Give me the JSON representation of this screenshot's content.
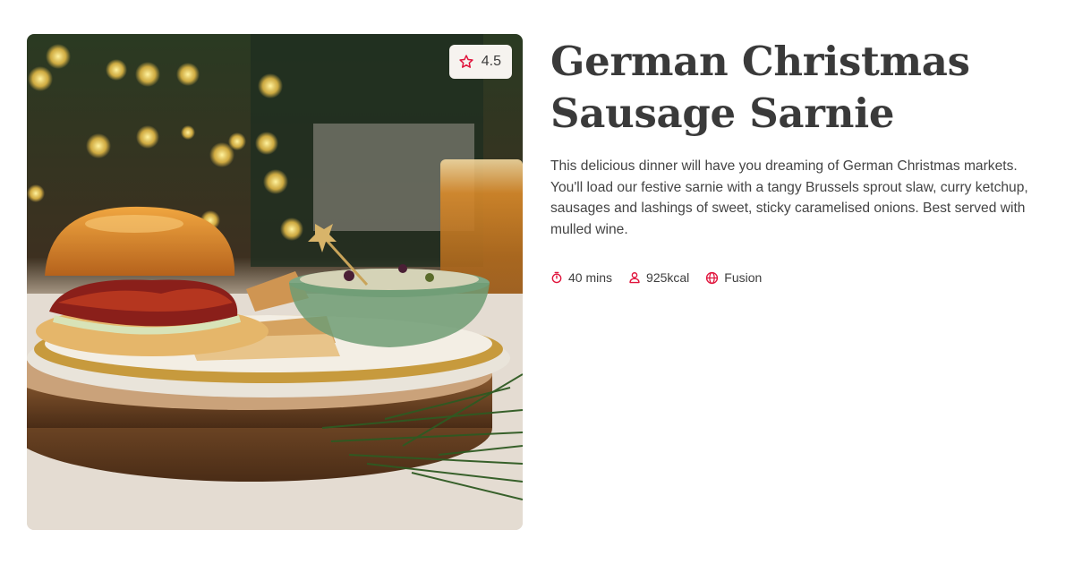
{
  "recipe": {
    "title": "German Christmas Sausage Sarnie",
    "description": "This delicious dinner will have you dreaming of German Christmas markets. You'll load our festive sarnie with a tangy Brussels sprout slaw, curry ketchup, sausages and lashings of sweet, sticky caramelised onions. Best served with mulled wine.",
    "rating": "4.5",
    "meta": {
      "time": "40 mins",
      "calories": "925kcal",
      "cuisine": "Fusion"
    }
  },
  "icons": {
    "rating": "star-outline-icon",
    "time": "stopwatch-icon",
    "calories": "person-icon",
    "cuisine": "globe-icon"
  },
  "colors": {
    "accent": "#e0143c",
    "title": "#3a3a3a",
    "text": "#444444",
    "badge_bg": "#f6f3ef"
  }
}
